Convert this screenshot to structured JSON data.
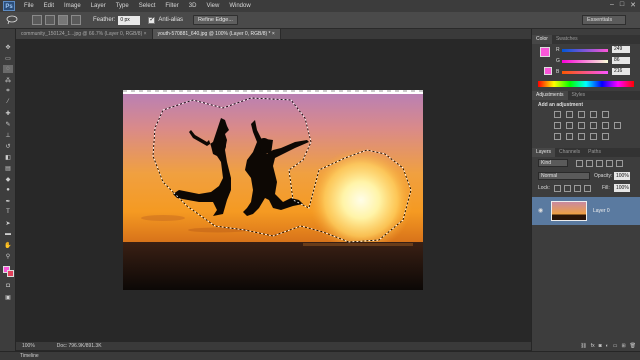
{
  "app": {
    "logo": "Ps"
  },
  "menubar": {
    "items": [
      "File",
      "Edit",
      "Image",
      "Layer",
      "Type",
      "Select",
      "Filter",
      "3D",
      "View",
      "Window"
    ],
    "window_controls": [
      "–",
      "□",
      "✕"
    ]
  },
  "options_bar": {
    "feather_label": "Feather:",
    "feather_value": "0 px",
    "antialias_label": "Anti-alias",
    "antialias_checked": "✓",
    "refine_edge_label": "Refine Edge...",
    "workspace": "Essentials"
  },
  "tabs": [
    {
      "label": "community_150124_1...jpg @ 66.7% (Layer 0, RGB/8) ×",
      "active": false
    },
    {
      "label": "youth-570881_640.jpg @ 100% (Layer 0, RGB/8) * ×",
      "active": true
    }
  ],
  "status": {
    "zoom": "100%",
    "doc": "Doc: 796.9K/891.3K",
    "timeline": "Timeline"
  },
  "color_panel": {
    "tabs": [
      "Color",
      "Swatches"
    ],
    "r_label": "R",
    "r_value": "249",
    "g_label": "G",
    "g_value": "86",
    "b_label": "B",
    "b_value": "216",
    "foreground_color": "#f956d8"
  },
  "adjustments_panel": {
    "tabs": [
      "Adjustments",
      "Styles"
    ],
    "heading": "Add an adjustment"
  },
  "layers_panel": {
    "tabs": [
      "Layers",
      "Channels",
      "Paths"
    ],
    "kind_label": "Kind",
    "blend_mode": "Normal",
    "opacity_label": "Opacity:",
    "opacity_value": "100%",
    "lock_label": "Lock:",
    "fill_label": "Fill:",
    "fill_value": "100%",
    "layer_name": "Layer 0"
  },
  "colors": {
    "ui_dark": "#282828",
    "panel": "#3d3d3d",
    "selected_layer": "#5a7aa0"
  }
}
